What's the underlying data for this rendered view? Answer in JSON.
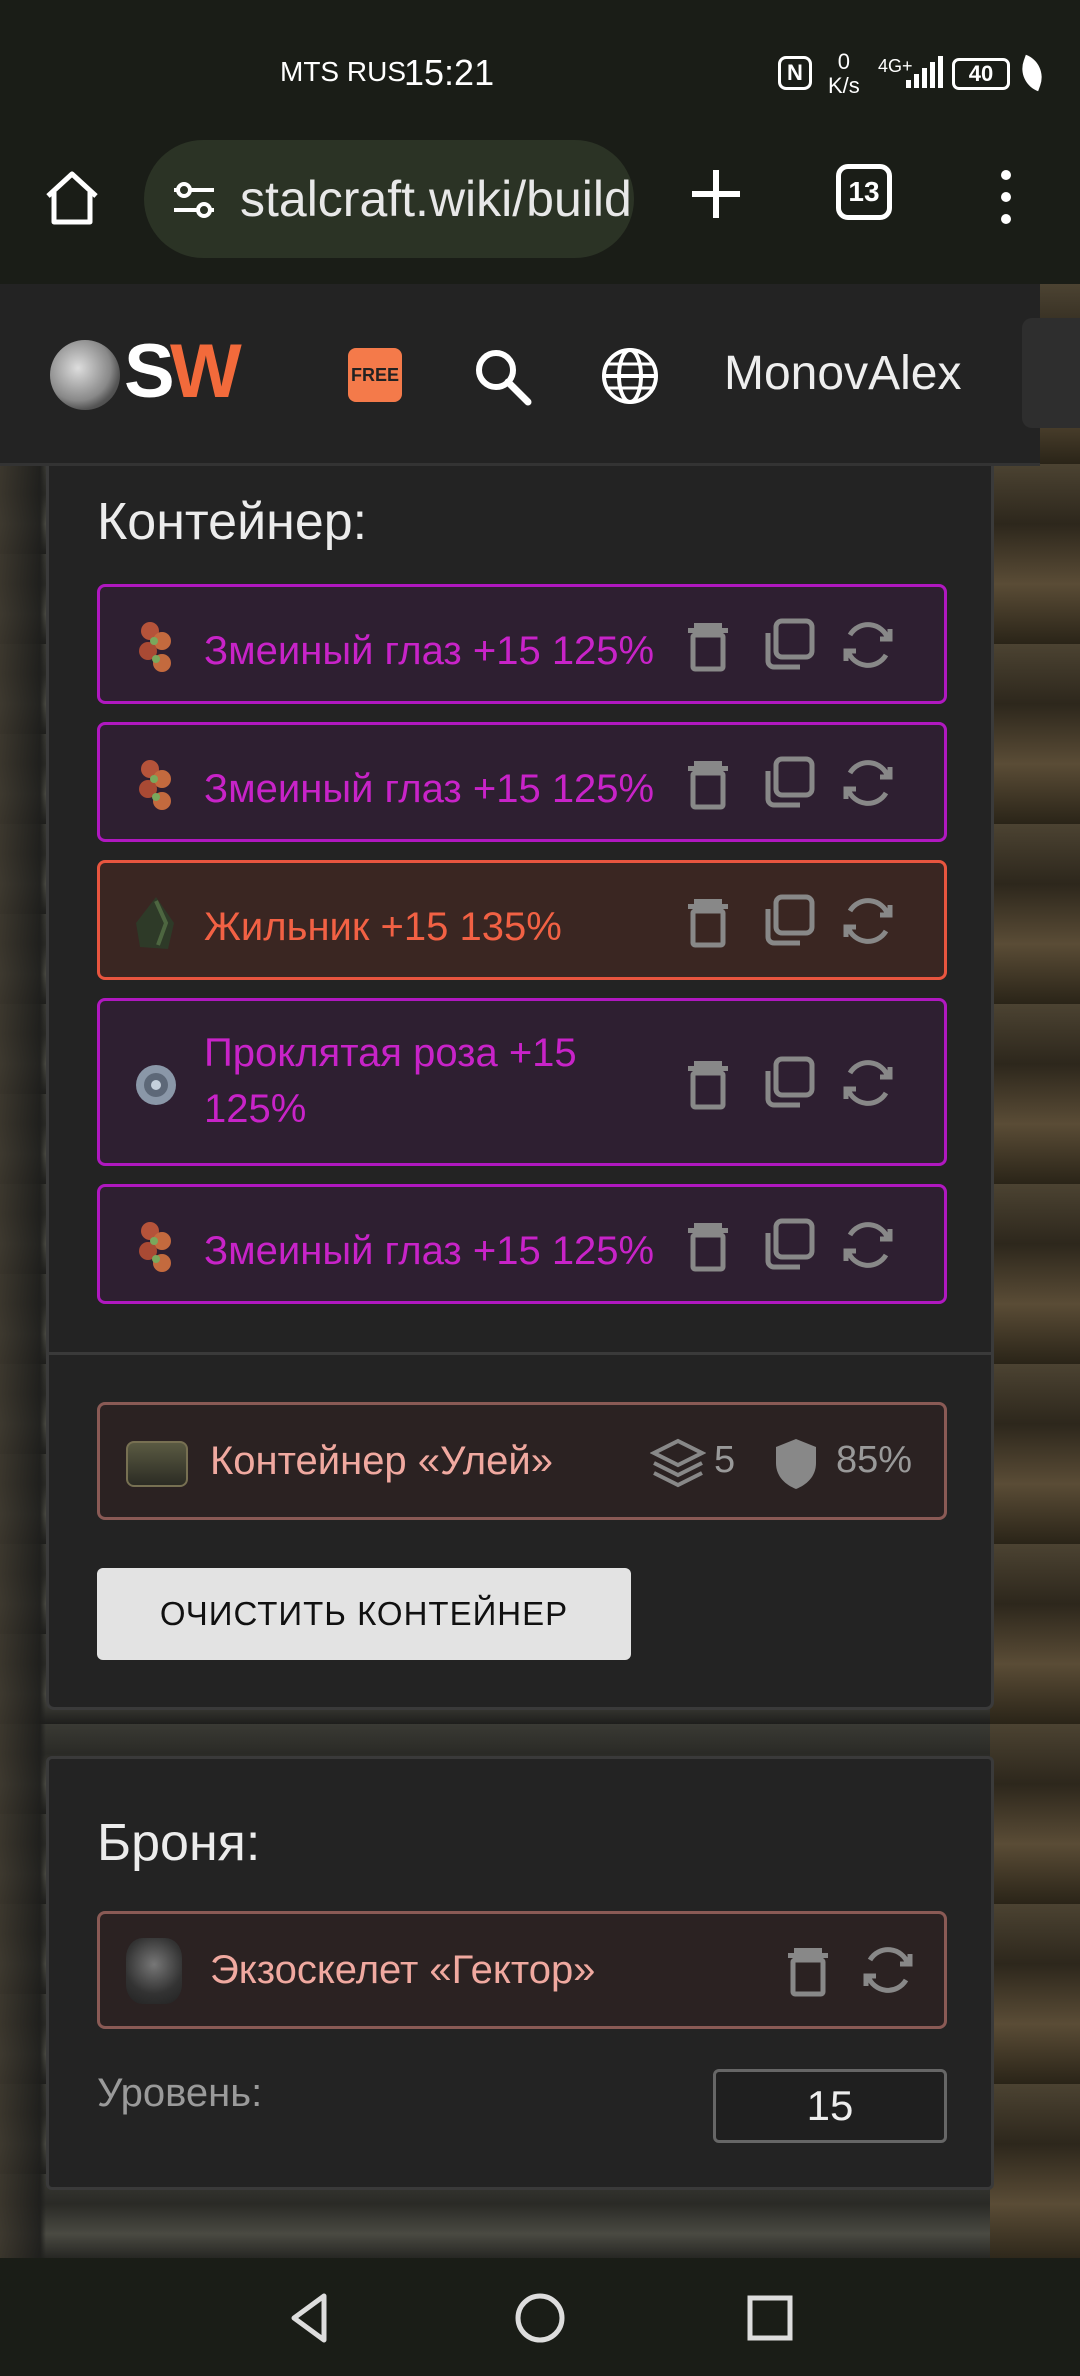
{
  "status_bar": {
    "carrier": "MTS RUS",
    "time": "15:21",
    "speed_value": "0",
    "speed_unit": "K/s",
    "network": "4G+",
    "battery": "40"
  },
  "browser": {
    "url": "stalcraft.wiki/build",
    "tab_count": "13"
  },
  "site_header": {
    "logo_s": "S",
    "logo_w": "W",
    "free_badge": "FREE",
    "username": "MonovAlex"
  },
  "container_section": {
    "title": "Контейнер:",
    "artifacts": [
      {
        "name": "Змеиный глаз +15 125%",
        "rarity_color": "#c823c8"
      },
      {
        "name": "Змеиный глаз +15 125%",
        "rarity_color": "#c823c8"
      },
      {
        "name": "Жильник +15 135%",
        "rarity_color": "#f26144"
      },
      {
        "name": "Проклятая роза +15 125%",
        "rarity_color": "#c823c8"
      },
      {
        "name": "Змеиный глаз +15 125%",
        "rarity_color": "#c823c8"
      }
    ],
    "container": {
      "name": "Контейнер «Улей»",
      "slots": "5",
      "protection": "85%"
    },
    "clear_button": "ОЧИСТИТЬ КОНТЕЙНЕР"
  },
  "armor_section": {
    "title": "Броня:",
    "armor_name": "Экзоскелет «Гектор»",
    "level_label": "Уровень:",
    "level_value": "15"
  },
  "colors": {
    "accent_orange": "#f26a3b",
    "purple_border": "#b018c0",
    "red_border": "#e8553f"
  }
}
